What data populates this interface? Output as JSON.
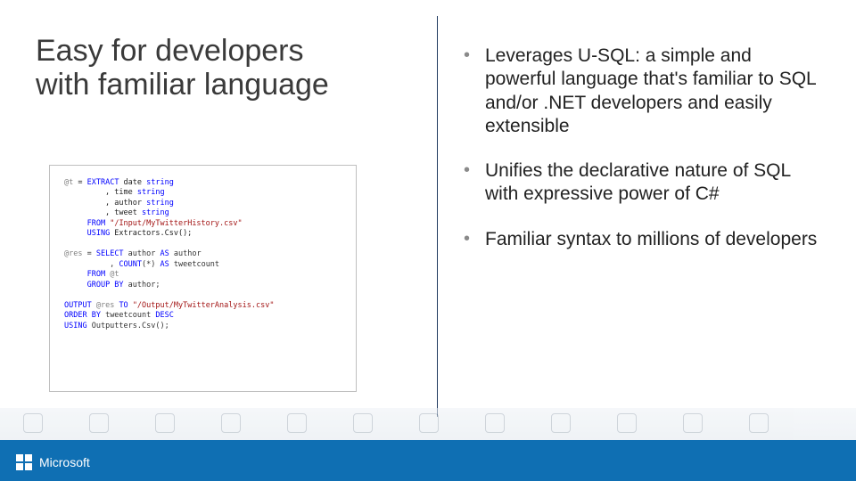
{
  "title_line1": "Easy for developers",
  "title_line2": "with familiar language",
  "bullets": [
    "Leverages U-SQL: a simple and powerful language that's familiar to SQL and/or .NET developers and easily extensible",
    "Unifies the declarative nature of SQL with expressive power of C#",
    "Familiar syntax to millions of developers"
  ],
  "code": {
    "l1a": "@t",
    "l1b": " = ",
    "l1c": "EXTRACT",
    "l1d": " date ",
    "l1e": "string",
    "l2a": "         , time ",
    "l2b": "string",
    "l3a": "         , author ",
    "l3b": "string",
    "l4a": "         , tweet ",
    "l4b": "string",
    "l5a": "     ",
    "l5b": "FROM",
    "l5c": " ",
    "l5d": "\"/Input/MyTwitterHistory.csv\"",
    "l6a": "     ",
    "l6b": "USING",
    "l6c": " Extractors.Csv();",
    "l7": "",
    "l8a": "@res",
    "l8b": " = ",
    "l8c": "SELECT",
    "l8d": " author ",
    "l8e": "AS",
    "l8f": " author",
    "l9a": "          , ",
    "l9b": "COUNT",
    "l9c": "(*) ",
    "l9d": "AS",
    "l9e": " tweetcount",
    "l10a": "     ",
    "l10b": "FROM",
    "l10c": " @t",
    "l11a": "     ",
    "l11b": "GROUP BY",
    "l11c": " author;",
    "l12": "",
    "l13a": "OUTPUT",
    "l13b": " @res ",
    "l13c": "TO",
    "l13d": " ",
    "l13e": "\"/Output/MyTwitterAnalysis.csv\"",
    "l14a": "ORDER BY",
    "l14b": " tweetcount ",
    "l14c": "DESC",
    "l15a": "USING",
    "l15b": " Outputters.Csv();"
  },
  "footer": {
    "brand": "Microsoft"
  }
}
